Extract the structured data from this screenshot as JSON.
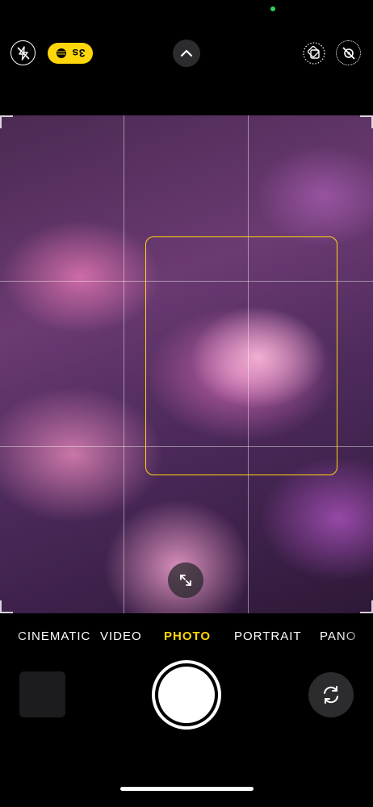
{
  "top_controls": {
    "timer_value": "3s"
  },
  "modes": {
    "cinematic": "CINEMATIC",
    "video": "VIDEO",
    "photo": "PHOTO",
    "portrait": "PORTRAIT",
    "pano": "PANO",
    "active": "PHOTO"
  },
  "icons": {
    "flash": "flash-off-icon",
    "timer": "timer-icon",
    "chevron": "chevron-up-icon",
    "live": "live-photo-icon",
    "orientation": "orientation-lock-icon",
    "expand": "expand-icon",
    "switch": "switch-camera-icon"
  },
  "colors": {
    "accent": "#ffd60a",
    "indicator": "#30d158",
    "background": "#000000"
  }
}
